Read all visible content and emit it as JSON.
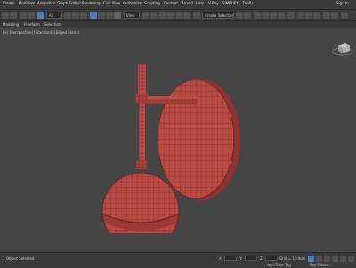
{
  "menubar": {
    "items": [
      "Create",
      "Modifiers",
      "Animation",
      "Graph Editors",
      "Rendering",
      "Civil View",
      "Customize",
      "Scripting",
      "Content",
      "Arnold",
      "Help",
      "V-Ray",
      "SIMPLIFY",
      "ZebRa"
    ],
    "search_label": "Sign In"
  },
  "toolbar": {
    "filter_dropdown": "All",
    "view_dropdown": "View",
    "selection_set_dropdown": "Create Selection Se"
  },
  "ribbon": {
    "tabs": [
      "Modeling",
      "Freeform",
      "Selection"
    ]
  },
  "viewport": {
    "label": "[+] [Perspective] [Standard] [Edged Faces]",
    "model_color": "#b94a44",
    "wire_color": "#6a1f1c",
    "background_color": "#454545"
  },
  "statusbar": {
    "left_text": "1 Object Selected",
    "x_label": "X:",
    "x_value": "",
    "y_label": "Y:",
    "y_value": "",
    "z_label": "Z:",
    "z_value": "",
    "grid_text": "Grid = 10.0cm",
    "autokey_label": "Add Time Tag",
    "autokey_color": "#4f7fb5",
    "key_filter": "Key Filters..."
  }
}
